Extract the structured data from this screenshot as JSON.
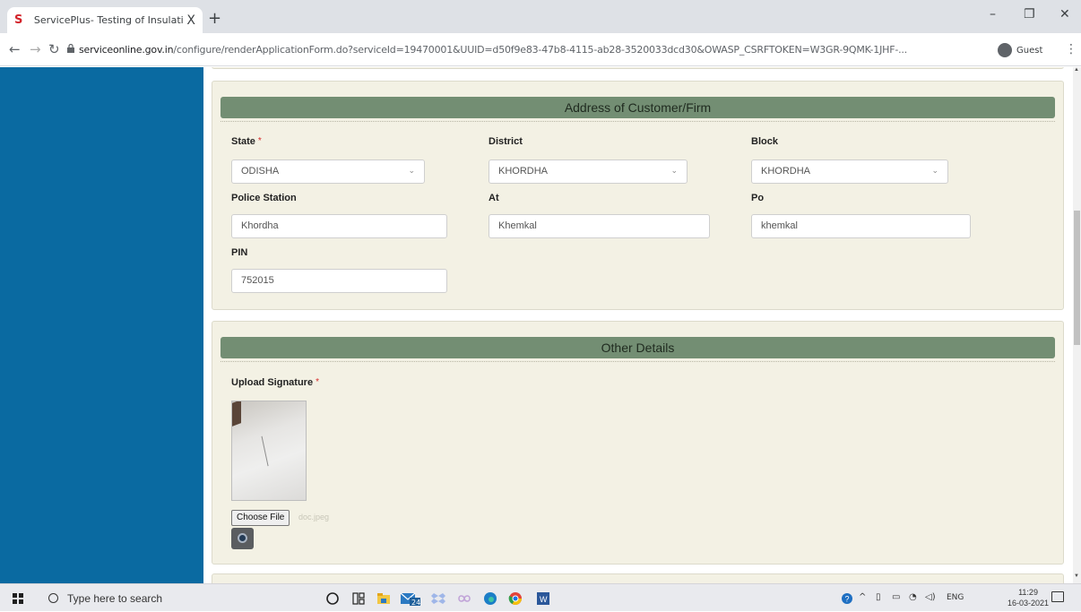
{
  "browser": {
    "tab_title": "ServicePlus- Testing of Insulation",
    "tab_close": "X",
    "new_tab": "+",
    "url_domain": "serviceonline.gov.in",
    "url_path": "/configure/renderApplicationForm.do?serviceId=19470001&UUID=d50f9e83-47b8-4115-ab28-3520033dcd30&OWASP_CSRFTOKEN=W3GR-9QMK-1JHF-...",
    "profile_label": "Guest"
  },
  "address_section": {
    "heading": "Address of Customer/Firm",
    "state_label": "State",
    "state_value": "ODISHA",
    "district_label": "District",
    "district_value": "KHORDHA",
    "block_label": "Block",
    "block_value": "KHORDHA",
    "police_station_label": "Police Station",
    "police_station_value": "Khordha",
    "at_label": "At",
    "at_value": "Khemkal",
    "po_label": "Po",
    "po_value": "khemkal",
    "pin_label": "PIN",
    "pin_value": "752015",
    "required_mark": "*"
  },
  "other_section": {
    "heading": "Other Details",
    "upload_signature_label": "Upload Signature",
    "required_mark": "*",
    "choose_file_label": "Choose File",
    "file_name": "doc.jpeg"
  },
  "taskbar": {
    "search_placeholder": "Type here to search",
    "language": "ENG",
    "time": "11:29",
    "date": "16-03-2021",
    "edge_badge": "24"
  },
  "colors": {
    "sidebar": "#0a6aa1",
    "section_header": "#738e73",
    "panel_background": "#f3f1e4"
  }
}
